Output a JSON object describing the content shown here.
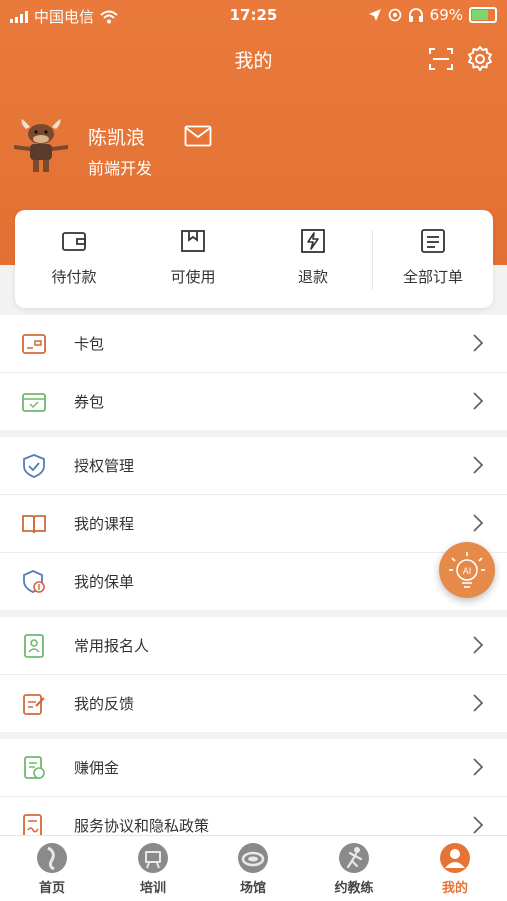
{
  "status_bar": {
    "carrier": "中国电信",
    "time": "17:25",
    "battery": "69%"
  },
  "header": {
    "title": "我的"
  },
  "profile": {
    "name": "陈凯浪",
    "role": "前端开发"
  },
  "orders": [
    {
      "label": "待付款",
      "icon": "wallet-icon"
    },
    {
      "label": "可使用",
      "icon": "box-icon"
    },
    {
      "label": "退款",
      "icon": "lightning-icon"
    },
    {
      "label": "全部订单",
      "icon": "order-list-icon"
    }
  ],
  "menu_groups": [
    [
      {
        "label": "卡包",
        "icon": "card-icon"
      },
      {
        "label": "券包",
        "icon": "coupon-icon"
      }
    ],
    [
      {
        "label": "授权管理",
        "icon": "shield-check-icon"
      },
      {
        "label": "我的课程",
        "icon": "book-icon"
      },
      {
        "label": "我的保单",
        "icon": "insurance-icon"
      }
    ],
    [
      {
        "label": "常用报名人",
        "icon": "contact-card-icon"
      },
      {
        "label": "我的反馈",
        "icon": "edit-icon"
      }
    ],
    [
      {
        "label": "赚佣金",
        "icon": "document-coin-icon"
      },
      {
        "label": "服务协议和隐私政策",
        "icon": "agreement-icon"
      }
    ]
  ],
  "fab": {
    "text": "AI"
  },
  "tabs": [
    {
      "label": "首页",
      "icon": "home-tab-icon"
    },
    {
      "label": "培训",
      "icon": "training-tab-icon"
    },
    {
      "label": "场馆",
      "icon": "venue-tab-icon"
    },
    {
      "label": "约教练",
      "icon": "coach-tab-icon"
    },
    {
      "label": "我的",
      "icon": "profile-tab-icon",
      "active": true
    }
  ],
  "colors": {
    "accent": "#e57537",
    "icon_orange": "#d2693a",
    "icon_green": "#6fba6f",
    "icon_blue": "#5b7bb5"
  }
}
